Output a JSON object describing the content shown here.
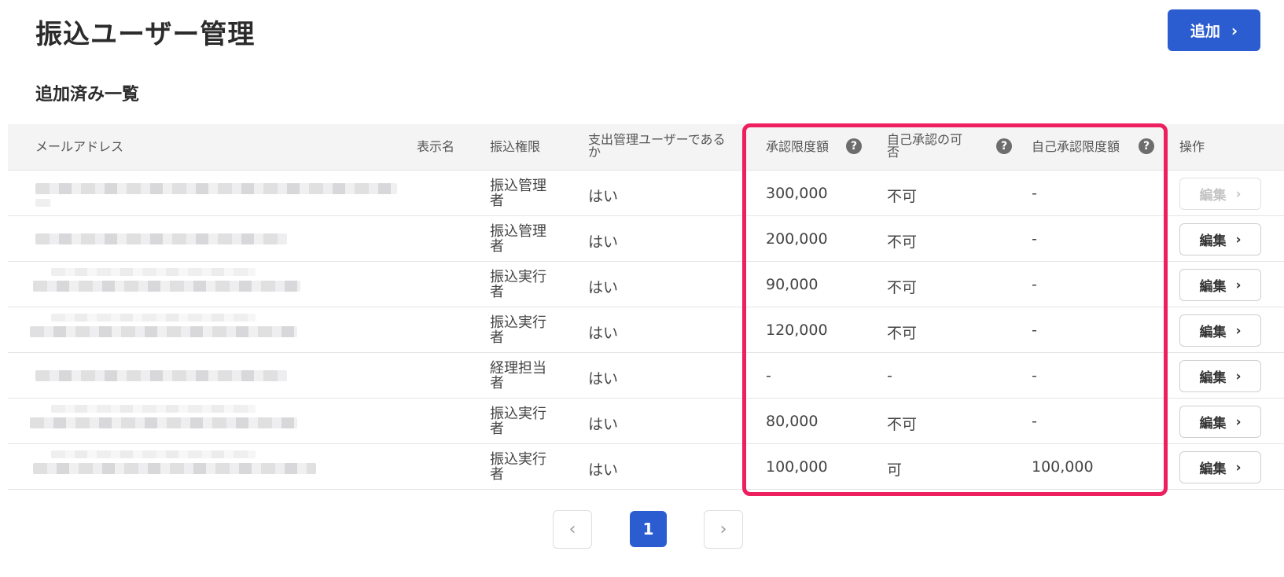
{
  "page": {
    "title": "振込ユーザー管理",
    "add_button_label": "追加",
    "section_title": "追加済み一覧",
    "accent_color": "#2b5dd1",
    "highlight_color": "#ee1f5e"
  },
  "table": {
    "headers": {
      "email": "メールアドレス",
      "display_name": "表示名",
      "permission": "振込権限",
      "expense_user_line1": "支出管理ユーザーである",
      "expense_user_line2": "か",
      "approval_limit": "承認限度額",
      "self_approval_line1": "自己承認の可",
      "self_approval_line2": "否",
      "self_approval_limit": "自己承認限度額",
      "actions": "操作"
    },
    "help_icon_glyph": "?",
    "edit_label": "編集",
    "rows": [
      {
        "role_line1": "振込管理",
        "role_line2": "者",
        "expense_user": "はい",
        "approval_limit": "300,000",
        "self_approval": "不可",
        "self_approval_limit": "-"
      },
      {
        "role_line1": "振込管理",
        "role_line2": "者",
        "expense_user": "はい",
        "approval_limit": "200,000",
        "self_approval": "不可",
        "self_approval_limit": "-"
      },
      {
        "role_line1": "振込実行",
        "role_line2": "者",
        "expense_user": "はい",
        "approval_limit": "90,000",
        "self_approval": "不可",
        "self_approval_limit": "-"
      },
      {
        "role_line1": "振込実行",
        "role_line2": "者",
        "expense_user": "はい",
        "approval_limit": "120,000",
        "self_approval": "不可",
        "self_approval_limit": "-"
      },
      {
        "role_line1": "経理担当",
        "role_line2": "者",
        "expense_user": "はい",
        "approval_limit": "-",
        "self_approval": "-",
        "self_approval_limit": "-"
      },
      {
        "role_line1": "振込実行",
        "role_line2": "者",
        "expense_user": "はい",
        "approval_limit": "80,000",
        "self_approval": "不可",
        "self_approval_limit": "-"
      },
      {
        "role_line1": "振込実行",
        "role_line2": "者",
        "expense_user": "はい",
        "approval_limit": "100,000",
        "self_approval": "可",
        "self_approval_limit": "100,000"
      }
    ]
  },
  "pagination": {
    "current_page": "1",
    "prev_glyph": "‹",
    "next_glyph": "›"
  }
}
